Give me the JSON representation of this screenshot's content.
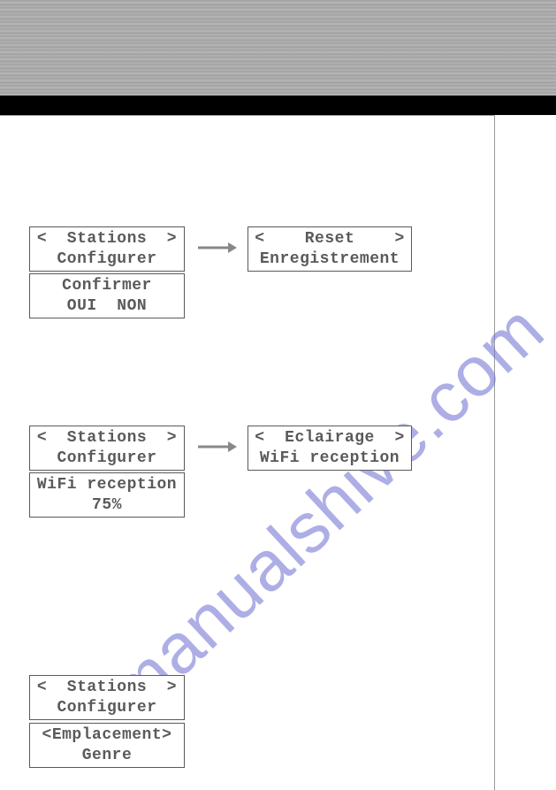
{
  "watermark": "manualshive.com",
  "group1": {
    "left": {
      "line1": "<  Stations  >",
      "line2": "Configurer"
    },
    "right": {
      "line1": "<    Reset    >",
      "line2": "Enregistrement"
    },
    "bottom": {
      "line1": "Confirmer",
      "line2": "OUI  NON"
    }
  },
  "group2": {
    "left": {
      "line1": "<  Stations  >",
      "line2": "Configurer"
    },
    "right": {
      "line1": "<  Eclairage  >",
      "line2": "WiFi reception"
    },
    "bottom": {
      "line1": "WiFi reception",
      "line2": "75%"
    }
  },
  "group3": {
    "top": {
      "line1": "<  Stations  >",
      "line2": "Configurer"
    },
    "bottom": {
      "line1": "<Emplacement>",
      "line2": "Genre"
    }
  }
}
